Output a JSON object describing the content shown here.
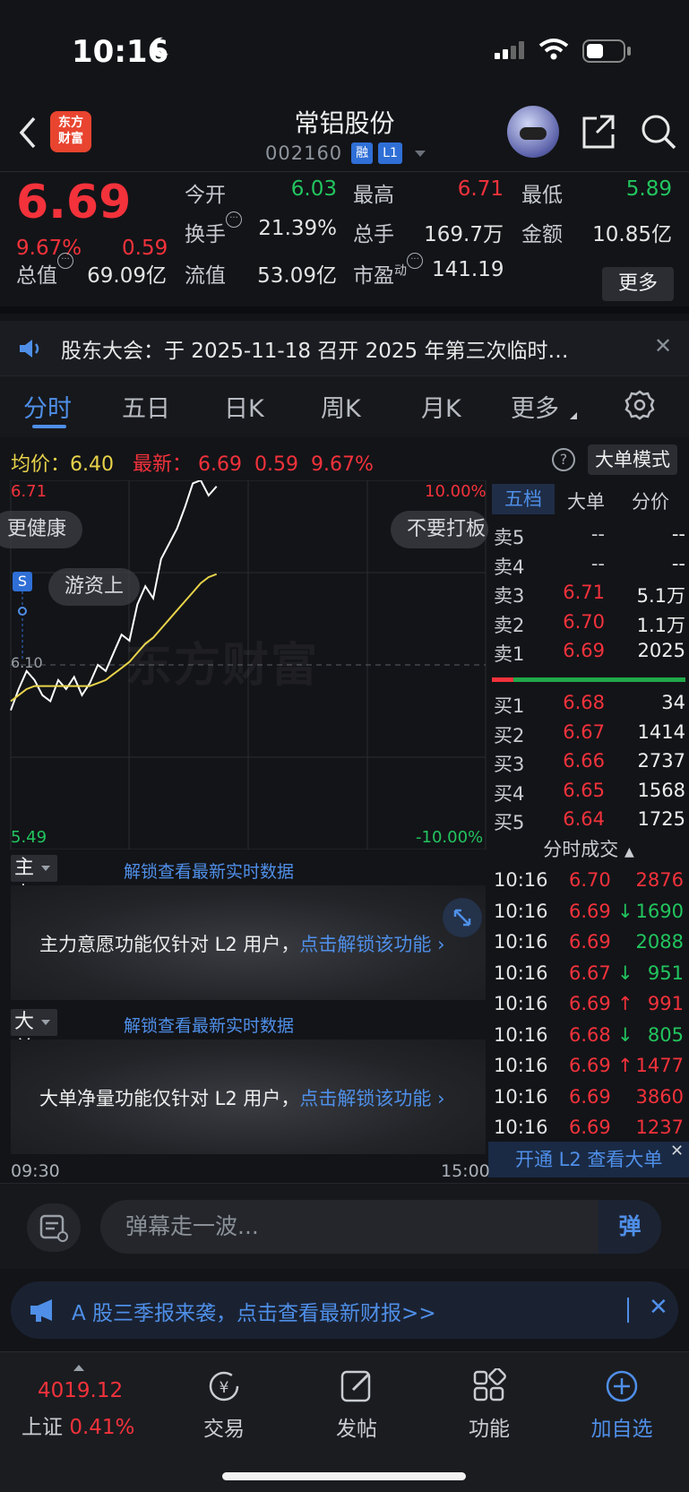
{
  "status_bar": {
    "time": "10:16"
  },
  "header": {
    "logo_line1": "东方",
    "logo_line2": "财富",
    "stock_name": "常铝股份",
    "stock_code": "002160",
    "tag_rong": "融",
    "tag_level": "L1"
  },
  "quote": {
    "price": "6.69",
    "change_pct": "9.67%",
    "change": "0.59",
    "open_label": "今开",
    "open": "6.03",
    "high_label": "最高",
    "high": "6.71",
    "low_label": "最低",
    "low": "5.89",
    "turnover_label": "换手",
    "turnover": "21.39%",
    "volume_label": "总手",
    "volume": "169.7万",
    "amount_label": "金额",
    "amount": "10.85亿",
    "mktcap_label": "总值",
    "mktcap": "69.09亿",
    "float_label": "流值",
    "float_cap": "53.09亿",
    "pe_label": "市盈",
    "pe_sup": "动",
    "pe": "141.19",
    "more_label": "更多"
  },
  "notice": {
    "text": "股东大会：于 2025-11-18 召开 2025 年第三次临时…"
  },
  "tabs": [
    "分时",
    "五日",
    "日K",
    "周K",
    "月K",
    "更多"
  ],
  "info_line": {
    "avg_label": "均价：6.40",
    "latest_label": "最新：",
    "latest_price": "6.69",
    "latest_change": "0.59",
    "latest_pct": "9.67%",
    "help": "?",
    "big_mode": "大单模式"
  },
  "chart": {
    "y_top": "6.71",
    "y_mid": "6.10",
    "y_bottom": "5.49",
    "pct_top": "10.00%",
    "pct_bottom": "-10.00%",
    "watermark": "东方财富",
    "marker": "S",
    "danmu": [
      "更健康",
      "不要打板",
      "游资上"
    ],
    "time_start": "09:30",
    "time_end": "15:00"
  },
  "chart_data": {
    "type": "line",
    "xlabel": "",
    "ylabel": "",
    "ylim": [
      5.49,
      6.71
    ],
    "x_range": [
      "09:30",
      "15:00"
    ],
    "series": [
      {
        "name": "",
        "values": [
          5.95,
          6.02,
          6.08,
          6.05,
          6.0,
          5.98,
          6.05,
          6.02,
          6.06,
          6.0,
          6.04,
          6.1,
          6.08,
          6.14,
          6.2,
          6.18,
          6.3,
          6.36,
          6.32,
          6.45,
          6.5,
          6.55,
          6.62,
          6.7,
          6.71,
          6.66,
          6.69
        ]
      },
      {
        "name": "均价",
        "values": [
          5.98,
          6.0,
          6.02,
          6.03,
          6.03,
          6.03,
          6.03,
          6.03,
          6.03,
          6.03,
          6.03,
          6.04,
          6.05,
          6.07,
          6.09,
          6.11,
          6.14,
          6.17,
          6.19,
          6.22,
          6.25,
          6.28,
          6.31,
          6.34,
          6.37,
          6.39,
          6.4
        ]
      }
    ]
  },
  "orderbook": {
    "tabs": [
      "五档",
      "大单",
      "分价"
    ],
    "asks": [
      {
        "label": "卖5",
        "price": "--",
        "vol": "--"
      },
      {
        "label": "卖4",
        "price": "--",
        "vol": "--"
      },
      {
        "label": "卖3",
        "price": "6.71",
        "vol": "5.1万"
      },
      {
        "label": "卖2",
        "price": "6.70",
        "vol": "1.1万"
      },
      {
        "label": "卖1",
        "price": "6.69",
        "vol": "2025"
      }
    ],
    "bids": [
      {
        "label": "买1",
        "price": "6.68",
        "vol": "34"
      },
      {
        "label": "买2",
        "price": "6.67",
        "vol": "1414"
      },
      {
        "label": "买3",
        "price": "6.66",
        "vol": "2737"
      },
      {
        "label": "买4",
        "price": "6.65",
        "vol": "1568"
      },
      {
        "label": "买5",
        "price": "6.64",
        "vol": "1725"
      }
    ]
  },
  "ticks": {
    "header": "分时成交",
    "rows": [
      {
        "time": "10:16",
        "price": "6.70",
        "arrow": "",
        "vol": "2876",
        "vol_color": "red"
      },
      {
        "time": "10:16",
        "price": "6.69",
        "arrow": "↓",
        "vol": "1690",
        "vol_color": "green"
      },
      {
        "time": "10:16",
        "price": "6.69",
        "arrow": "",
        "vol": "2088",
        "vol_color": "green"
      },
      {
        "time": "10:16",
        "price": "6.67",
        "arrow": "↓",
        "vol": "951",
        "vol_color": "green"
      },
      {
        "time": "10:16",
        "price": "6.69",
        "arrow": "↑",
        "vol": "991",
        "vol_color": "red"
      },
      {
        "time": "10:16",
        "price": "6.68",
        "arrow": "↓",
        "vol": "805",
        "vol_color": "green"
      },
      {
        "time": "10:16",
        "price": "6.69",
        "arrow": "↑",
        "vol": "1477",
        "vol_color": "red"
      },
      {
        "time": "10:16",
        "price": "6.69",
        "arrow": "",
        "vol": "3860",
        "vol_color": "red"
      },
      {
        "time": "10:16",
        "price": "6.69",
        "arrow": "",
        "vol": "1237",
        "vol_color": "red"
      }
    ],
    "l2_banner": "开通 L2 查看大单"
  },
  "indicators": {
    "main_intent": {
      "name": "主力意愿",
      "link": "解锁查看最新实时数据",
      "text": "主力意愿功能仅针对 L2 用户，",
      "cta": "点击解锁该功能 ›"
    },
    "big_net": {
      "name": "大单净量",
      "link": "解锁查看最新实时数据",
      "text": "大单净量功能仅针对 L2 用户，",
      "cta": "点击解锁该功能 ›"
    }
  },
  "comment": {
    "placeholder": "弹幕走一波...",
    "send": "弹"
  },
  "promo": {
    "text": "A 股三季报来袭，点击查看最新财报>>"
  },
  "bottom_nav": {
    "index_value": "4019.12",
    "index_name": "上证",
    "index_pct": "0.41%",
    "items": [
      "交易",
      "发帖",
      "功能",
      "加自选"
    ]
  }
}
